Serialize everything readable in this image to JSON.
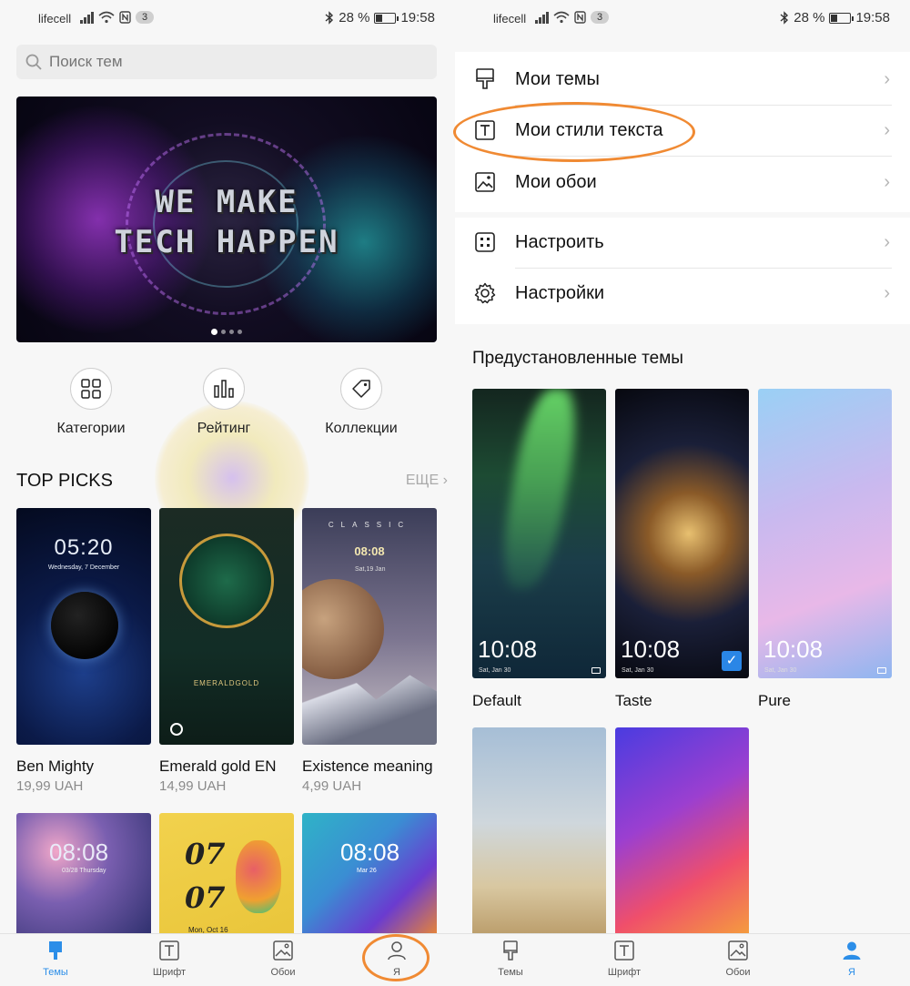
{
  "status_left": {
    "carrier": "lifecell",
    "badge": "3",
    "battery": "28 %",
    "time": "19:58"
  },
  "status_right": {
    "carrier": "lifecell",
    "badge": "3",
    "battery": "28 %",
    "time": "19:58"
  },
  "search": {
    "placeholder": "Поиск тем"
  },
  "banner": {
    "line1": "WE MAKE",
    "line2": "TECH HAPPEN",
    "slides_total": 4,
    "slide_active": 1
  },
  "categories": [
    {
      "label": "Категории",
      "icon": "grid-icon"
    },
    {
      "label": "Рейтинг",
      "icon": "bar-chart-icon"
    },
    {
      "label": "Коллекции",
      "icon": "tag-icon"
    }
  ],
  "top_picks": {
    "title": "TOP PICKS",
    "more": "ЕЩЕ",
    "items": [
      {
        "name": "Ben Mighty",
        "price": "19,99 UAH",
        "time": "05:20",
        "date": "Wednesday, 7 December"
      },
      {
        "name": "Emerald gold EN",
        "price": "14,99 UAH",
        "brand": "EMERALDGOLD"
      },
      {
        "name": "Existence meaning",
        "price": "4,99 UAH",
        "time": "08:08",
        "date": "Sat,19 Jan",
        "header": "CLASSIC"
      }
    ],
    "row2": [
      {
        "time": "08:08",
        "date": "03/28 Thursday"
      },
      {
        "time1": "07",
        "time2": "07",
        "date": "Mon, Oct 16"
      },
      {
        "time": "08:08",
        "date": "Mar 26"
      }
    ]
  },
  "menu": {
    "group1": [
      {
        "label": "Мои темы",
        "icon": "brush-icon"
      },
      {
        "label": "Мои стили текста",
        "icon": "text-style-icon"
      },
      {
        "label": "Мои обои",
        "icon": "wallpaper-icon"
      }
    ],
    "group2": [
      {
        "label": "Настроить",
        "icon": "customize-icon"
      },
      {
        "label": "Настройки",
        "icon": "settings-gear-icon"
      }
    ]
  },
  "preset": {
    "title": "Предустановленные темы",
    "items": [
      {
        "name": "Default",
        "time": "10:08",
        "date": "Sat, Jan 30",
        "selected": false
      },
      {
        "name": "Taste",
        "time": "10:08",
        "date": "Sat, Jan 30",
        "selected": true
      },
      {
        "name": "Pure",
        "time": "10:08",
        "date": "Sat, Jan 30",
        "selected": false
      }
    ]
  },
  "nav_left": [
    {
      "label": "Темы",
      "icon": "brush-icon",
      "active": true
    },
    {
      "label": "Шрифт",
      "icon": "font-icon",
      "active": false
    },
    {
      "label": "Обои",
      "icon": "image-icon",
      "active": false
    },
    {
      "label": "Я",
      "icon": "person-icon",
      "active": false
    }
  ],
  "nav_right": [
    {
      "label": "Темы",
      "icon": "brush-icon",
      "active": false
    },
    {
      "label": "Шрифт",
      "icon": "font-icon",
      "active": false
    },
    {
      "label": "Обои",
      "icon": "image-icon",
      "active": false
    },
    {
      "label": "Я",
      "icon": "person-icon",
      "active": true
    }
  ],
  "colors": {
    "accent": "#2c8ee8",
    "annotation": "#f08a33",
    "check": "#2a86e6"
  }
}
